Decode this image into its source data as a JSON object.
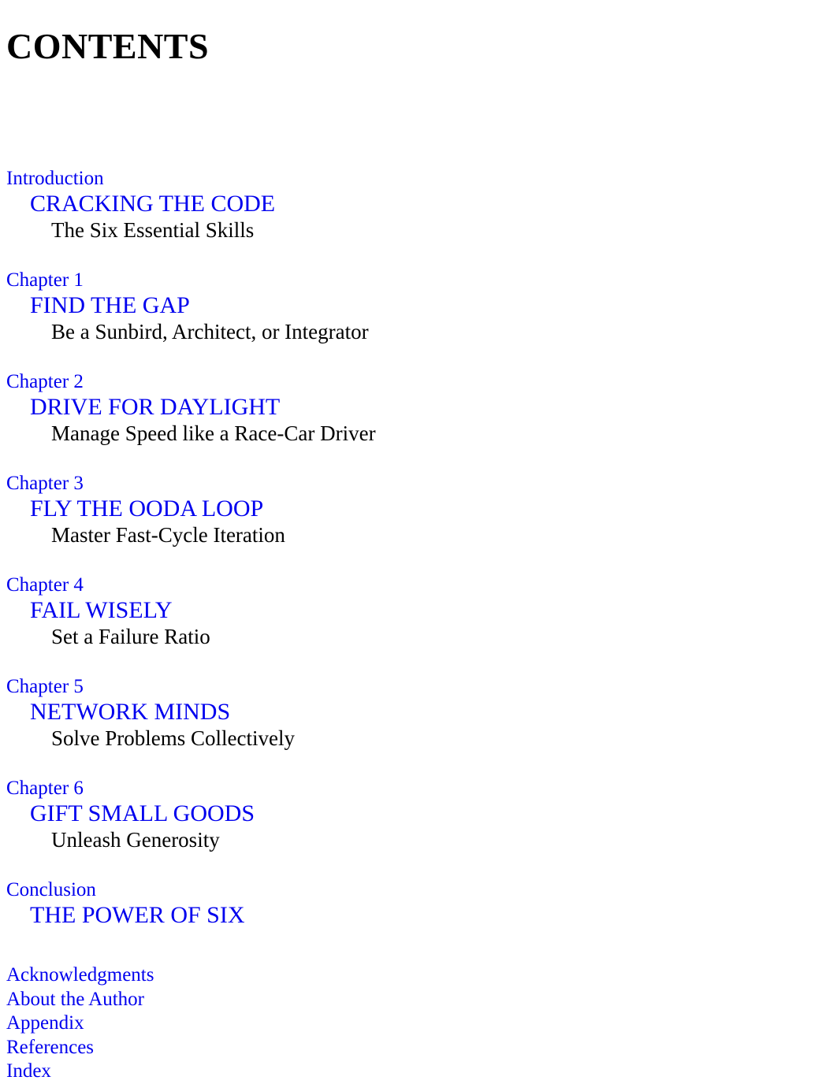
{
  "page": {
    "title": "CONTENTS",
    "text_color": "#000000",
    "link_color": "#0000ee",
    "background": "#ffffff"
  },
  "entries": [
    {
      "label": "Introduction",
      "title": "CRACKING THE CODE",
      "subtitle": "The Six Essential Skills"
    },
    {
      "label": "Chapter 1",
      "title": "FIND THE GAP",
      "subtitle": "Be a Sunbird, Architect, or Integrator"
    },
    {
      "label": "Chapter 2",
      "title": "DRIVE FOR DAYLIGHT",
      "subtitle": "Manage Speed like a Race-Car Driver"
    },
    {
      "label": "Chapter 3",
      "title": "FLY THE OODA LOOP",
      "subtitle": "Master Fast-Cycle Iteration"
    },
    {
      "label": "Chapter 4",
      "title": "FAIL WISELY",
      "subtitle": "Set a Failure Ratio"
    },
    {
      "label": "Chapter 5",
      "title": "NETWORK MINDS",
      "subtitle": "Solve Problems Collectively"
    },
    {
      "label": "Chapter 6",
      "title": "GIFT SMALL GOODS",
      "subtitle": "Unleash Generosity"
    },
    {
      "label": "Conclusion",
      "title": "THE POWER OF SIX",
      "subtitle": null
    }
  ],
  "backmatter": [
    {
      "label": "Acknowledgments"
    },
    {
      "label": "About the Author"
    },
    {
      "label": "Appendix"
    },
    {
      "label": "References"
    },
    {
      "label": "Index"
    }
  ]
}
